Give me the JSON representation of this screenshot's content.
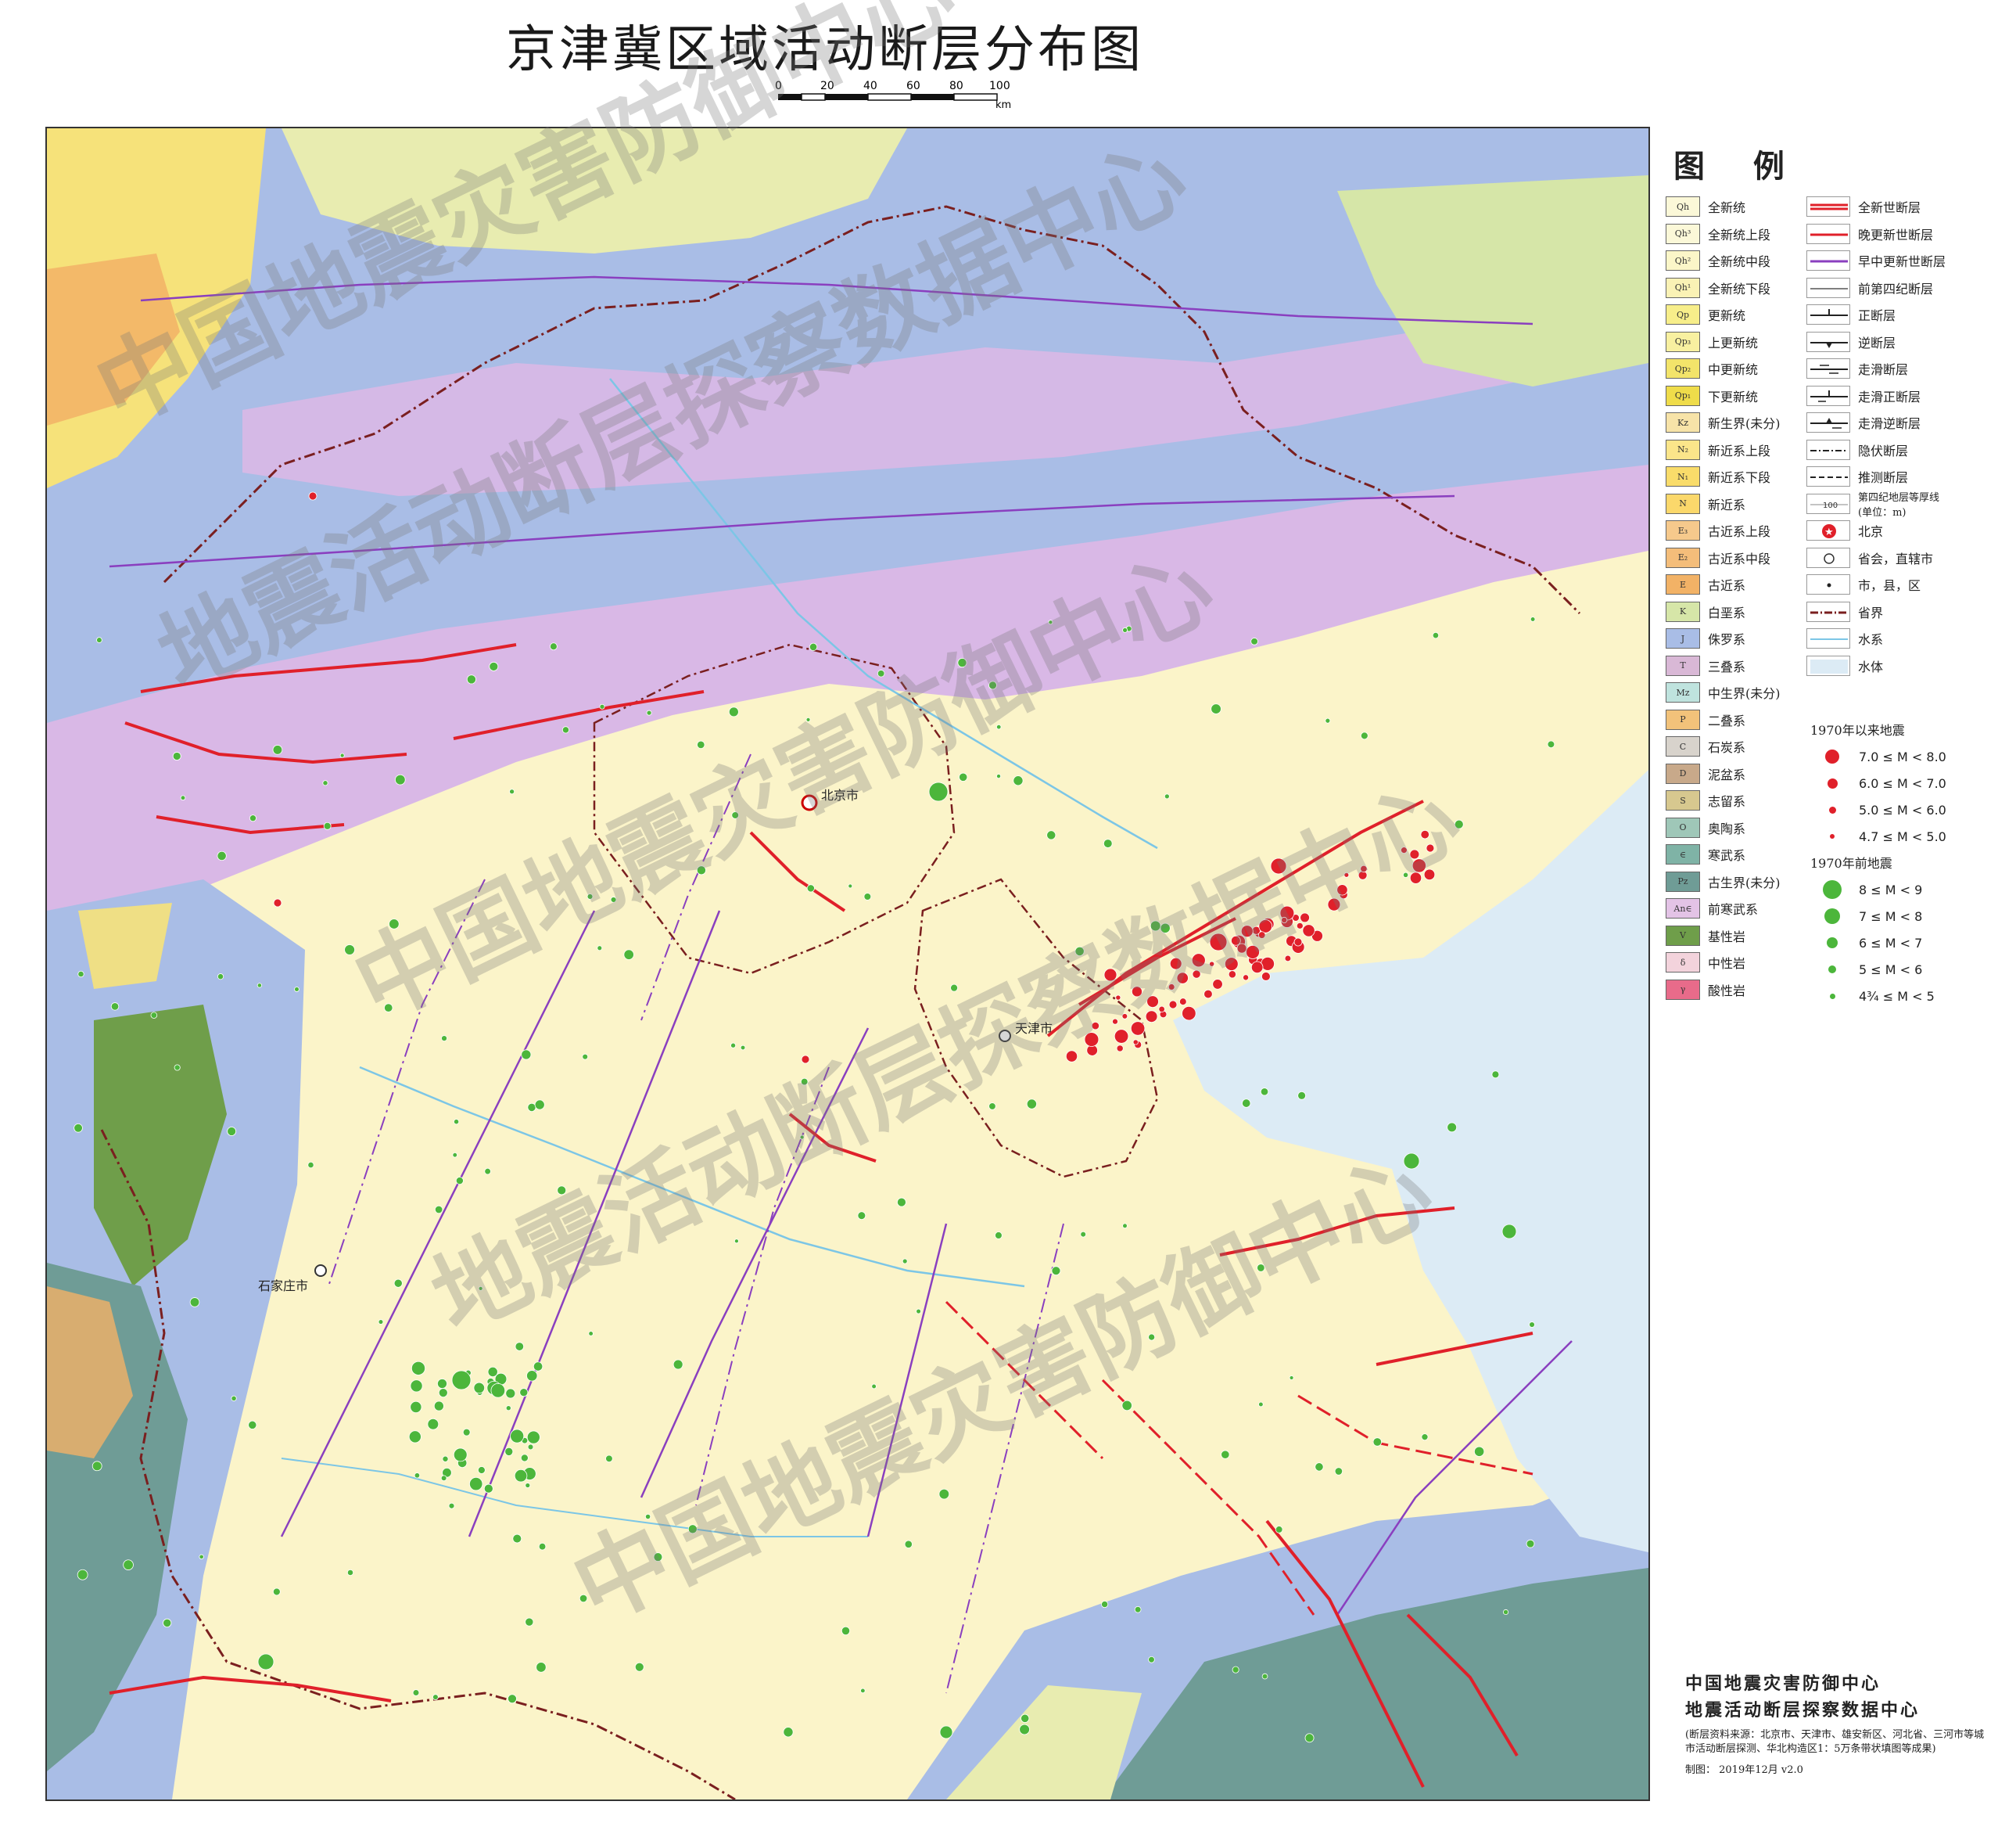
{
  "title": "京津冀区域活动断层分布图",
  "scale": {
    "ticks": [
      "0",
      "20",
      "40",
      "60",
      "80",
      "100"
    ],
    "unit": "km"
  },
  "colors": {
    "quaternary": "#fbf4c9",
    "jurassic": "#a9bde6",
    "precambrian": "#d9b8e6",
    "sea": "#dcebf5",
    "fault_active": "#e0202a",
    "fault_preq": "#8a3fbf",
    "eq_new": "#e0202a",
    "eq_old": "#4cb63b"
  },
  "cities": {
    "beijing": "北京市",
    "tianjin": "天津市",
    "shijiazhuang": "石家庄市"
  },
  "legend": {
    "title": "图 例",
    "strata": [
      {
        "code": "Qh",
        "label": "全新统",
        "color": "#fbf8d8"
      },
      {
        "code": "Qh³",
        "label": "全新统上段",
        "color": "#fbf8d8"
      },
      {
        "code": "Qh²",
        "label": "全新统中段",
        "color": "#fbf6c8"
      },
      {
        "code": "Qh¹",
        "label": "全新统下段",
        "color": "#faf2b5"
      },
      {
        "code": "Qp",
        "label": "更新统",
        "color": "#f7ee8a"
      },
      {
        "code": "Qp₃",
        "label": "上更新统",
        "color": "#f8f0a0"
      },
      {
        "code": "Qp₂",
        "label": "中更新统",
        "color": "#f3e46a"
      },
      {
        "code": "Qp₁",
        "label": "下更新统",
        "color": "#efdc4a"
      },
      {
        "code": "Kz",
        "label": "新生界(未分)",
        "color": "#f7e3a8"
      },
      {
        "code": "N₂",
        "label": "新近系上段",
        "color": "#fbe58a"
      },
      {
        "code": "N₁",
        "label": "新近系下段",
        "color": "#f9dc6a"
      },
      {
        "code": "N",
        "label": "新近系",
        "color": "#fbd86b"
      },
      {
        "code": "E₃",
        "label": "古近系上段",
        "color": "#f6c98c"
      },
      {
        "code": "E₂",
        "label": "古近系中段",
        "color": "#f4bd7a"
      },
      {
        "code": "E",
        "label": "古近系",
        "color": "#f2b266"
      },
      {
        "code": "K",
        "label": "白垩系",
        "color": "#d6e6a8"
      },
      {
        "code": "J",
        "label": "侏罗系",
        "color": "#a9bde6"
      },
      {
        "code": "T",
        "label": "三叠系",
        "color": "#d9b8d6"
      },
      {
        "code": "Mz",
        "label": "中生界(未分)",
        "color": "#bfe3de"
      },
      {
        "code": "P",
        "label": "二叠系",
        "color": "#f2c27a"
      },
      {
        "code": "C",
        "label": "石炭系",
        "color": "#d8d3cc"
      },
      {
        "code": "D",
        "label": "泥盆系",
        "color": "#c8a98a"
      },
      {
        "code": "S",
        "label": "志留系",
        "color": "#d7c88f"
      },
      {
        "code": "O",
        "label": "奥陶系",
        "color": "#9fc7b8"
      },
      {
        "code": "∈",
        "label": "寒武系",
        "color": "#7fb3a6"
      },
      {
        "code": "Pz",
        "label": "古生界(未分)",
        "color": "#6f9c96"
      },
      {
        "code": "An∈",
        "label": "前寒武系",
        "color": "#e3c3e6"
      },
      {
        "code": "V",
        "label": "基性岩",
        "color": "#6f9e4a"
      },
      {
        "code": "δ",
        "label": "中性岩",
        "color": "#f3d3dc"
      },
      {
        "code": "γ",
        "label": "酸性岩",
        "color": "#e86b8a"
      }
    ],
    "symbols": [
      {
        "label": "全新世断层",
        "type": "holocene"
      },
      {
        "label": "晚更新世断层",
        "type": "late-pleistocene"
      },
      {
        "label": "早中更新世断层",
        "type": "early-mid-pleistocene"
      },
      {
        "label": "前第四纪断层",
        "type": "pre-quaternary"
      },
      {
        "label": "正断层",
        "type": "normal"
      },
      {
        "label": "逆断层",
        "type": "reverse"
      },
      {
        "label": "走滑断层",
        "type": "strike-slip"
      },
      {
        "label": "走滑正断层",
        "type": "strike-slip-normal"
      },
      {
        "label": "走滑逆断层",
        "type": "strike-slip-reverse"
      },
      {
        "label": "隐伏断层",
        "type": "buried"
      },
      {
        "label": "推测断层",
        "type": "inferred"
      },
      {
        "label": "第四纪地层等厚线\n(单位：m)",
        "type": "isopach",
        "value": "100"
      },
      {
        "label": "北京",
        "type": "capital"
      },
      {
        "label": "省会，直辖市",
        "type": "provincial"
      },
      {
        "label": "市，县，区",
        "type": "county"
      },
      {
        "label": "省界",
        "type": "boundary"
      },
      {
        "label": "水系",
        "type": "river"
      },
      {
        "label": "水体",
        "type": "water"
      }
    ],
    "eq_after_title": "1970年以来地震",
    "eq_after": [
      {
        "label": "7.0 ≤ M < 8.0",
        "size": 9
      },
      {
        "label": "6.0 ≤ M < 7.0",
        "size": 6.5
      },
      {
        "label": "5.0 ≤ M < 6.0",
        "size": 4.5
      },
      {
        "label": "4.7 ≤ M < 5.0",
        "size": 3
      }
    ],
    "eq_before_title": "1970年前地震",
    "eq_before": [
      {
        "label": "8 ≤ M < 9",
        "size": 12
      },
      {
        "label": "7 ≤ M < 8",
        "size": 10
      },
      {
        "label": "6 ≤ M < 7",
        "size": 7
      },
      {
        "label": "5 ≤ M < 6",
        "size": 5
      },
      {
        "label": "4¾ ≤ M < 5",
        "size": 3.5
      }
    ]
  },
  "org": {
    "line1": "中国地震灾害防御中心",
    "line2": "地震活动断层探察数据中心",
    "note": "(断层资料来源：北京市、天津市、雄安新区、河北省、三河市等城市活动断层探测、华北构造区1：5万条带状填图等成果)",
    "credit": "制图：  2019年12月   v2.0"
  },
  "watermarks": [
    "中国地震灾害防御中心",
    "地震活动断层探察数据中心"
  ]
}
